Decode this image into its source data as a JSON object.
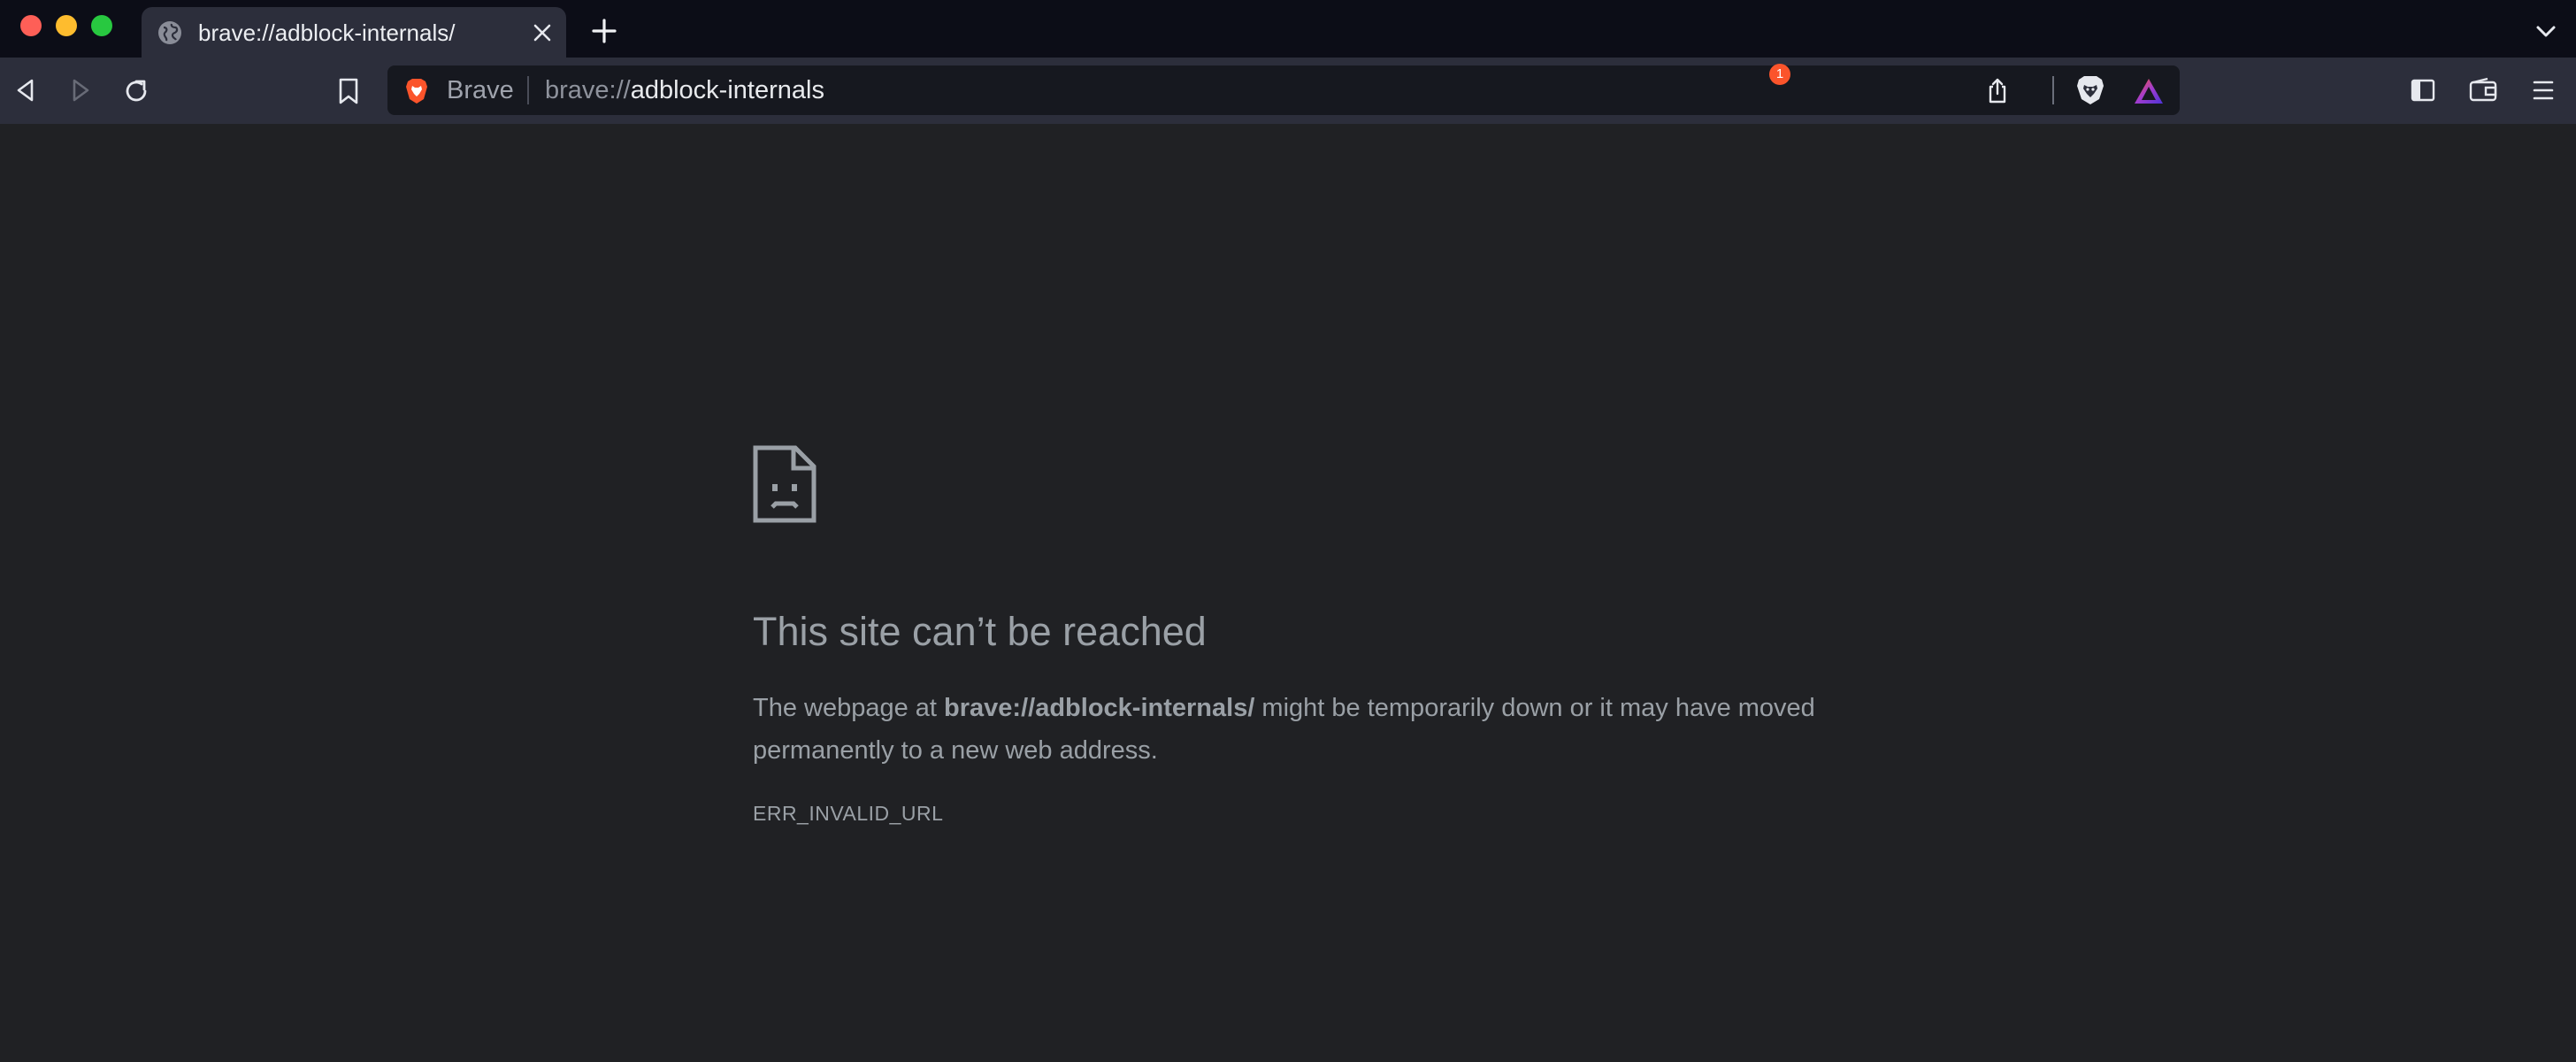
{
  "window": {
    "controls": [
      "close",
      "minimize",
      "zoom"
    ]
  },
  "tab": {
    "title": "brave://adblock-internals/",
    "favicon": "globe-icon"
  },
  "toolbar": {
    "back_icon": "back-arrow-icon",
    "forward_icon": "forward-arrow-icon",
    "reload_icon": "reload-icon",
    "bookmark_icon": "bookmark-icon"
  },
  "omnibox": {
    "brand_label": "Brave",
    "url_scheme": "brave://",
    "url_host": "adblock-internals",
    "rewards_badge": "1"
  },
  "error_page": {
    "heading": "This site can’t be reached",
    "desc_prefix": "The webpage at ",
    "desc_url": "brave://adblock-internals/",
    "desc_suffix": " might be temporarily down or it may have moved permanently to a new web address.",
    "error_code": "ERR_INVALID_URL"
  },
  "colors": {
    "tabstrip_bg": "#0c0d17",
    "toolbar_bg": "#2c2e3b",
    "omnibox_bg": "#16181f",
    "page_bg": "#202124",
    "text_muted": "#9aa0a6",
    "badge": "#fb542b"
  }
}
